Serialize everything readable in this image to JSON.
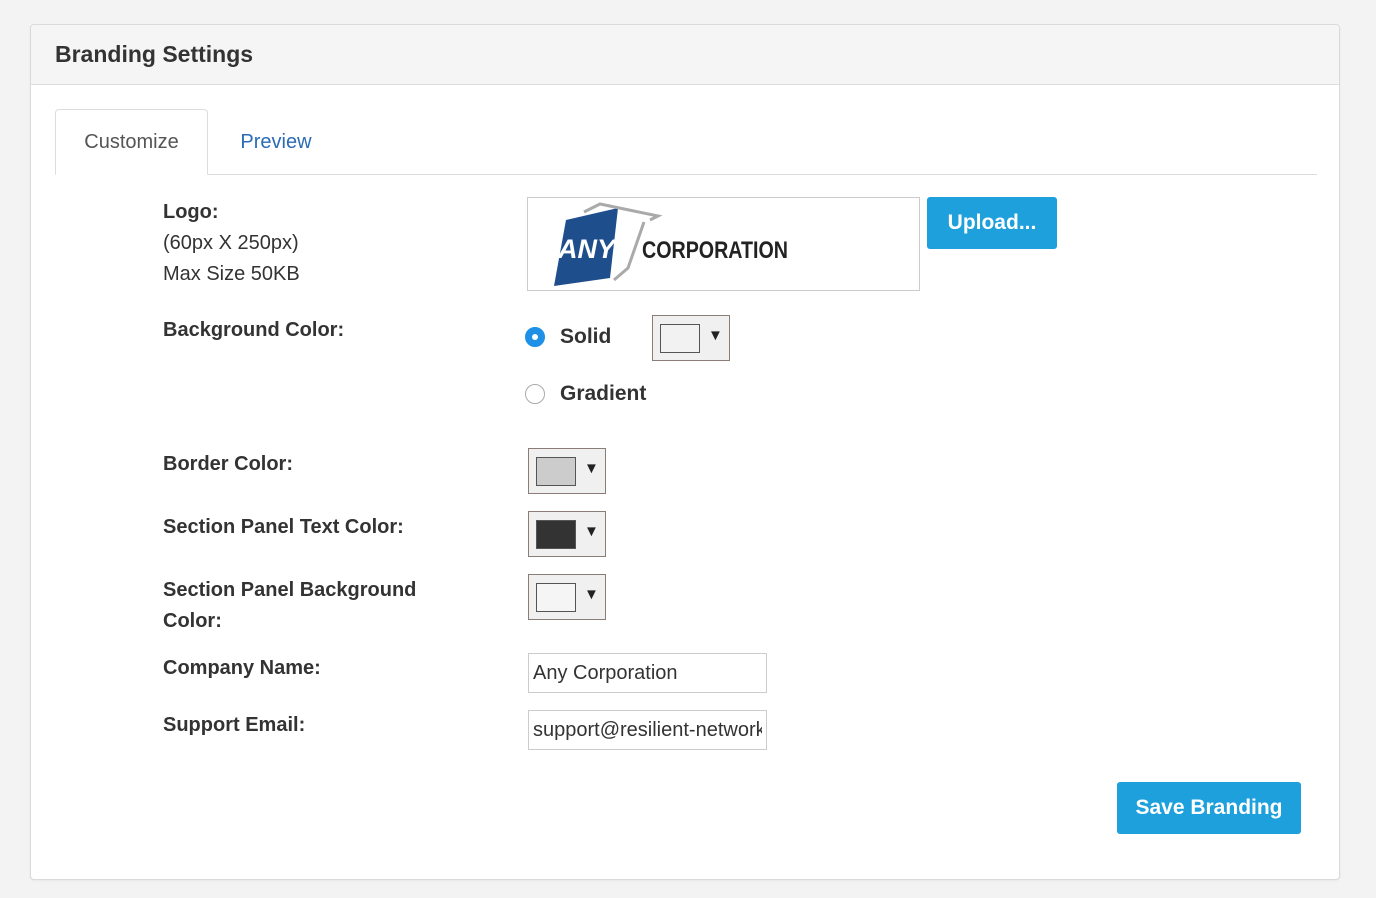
{
  "panel": {
    "title": "Branding Settings"
  },
  "tabs": [
    {
      "label": "Customize",
      "active": true
    },
    {
      "label": "Preview",
      "active": false
    }
  ],
  "logo": {
    "label": "Logo:",
    "dimensions": "(60px X 250px)",
    "max_size": "Max Size 50KB",
    "image_text_any": "ANY",
    "image_text_corp": "CORPORATION",
    "upload_label": "Upload..."
  },
  "background_color": {
    "label": "Background Color:",
    "options": [
      {
        "label": "Solid",
        "checked": true
      },
      {
        "label": "Gradient",
        "checked": false
      }
    ],
    "solid_swatch": "#f2f2f2"
  },
  "border_color": {
    "label": "Border Color:",
    "swatch": "#cccccc"
  },
  "section_panel_text_color": {
    "label": "Section Panel Text Color:",
    "swatch": "#333333"
  },
  "section_panel_background_color": {
    "label": "Section Panel Background Color:",
    "swatch": "#f5f5f5"
  },
  "company_name": {
    "label": "Company Name:",
    "value": "Any Corporation"
  },
  "support_email": {
    "label": "Support Email:",
    "value": "support@resilient-networks.com"
  },
  "save_label": "Save Branding",
  "colors": {
    "accent": "#1ea0dc",
    "link": "#2a6cb5",
    "logo_blue": "#1f4e8c"
  }
}
